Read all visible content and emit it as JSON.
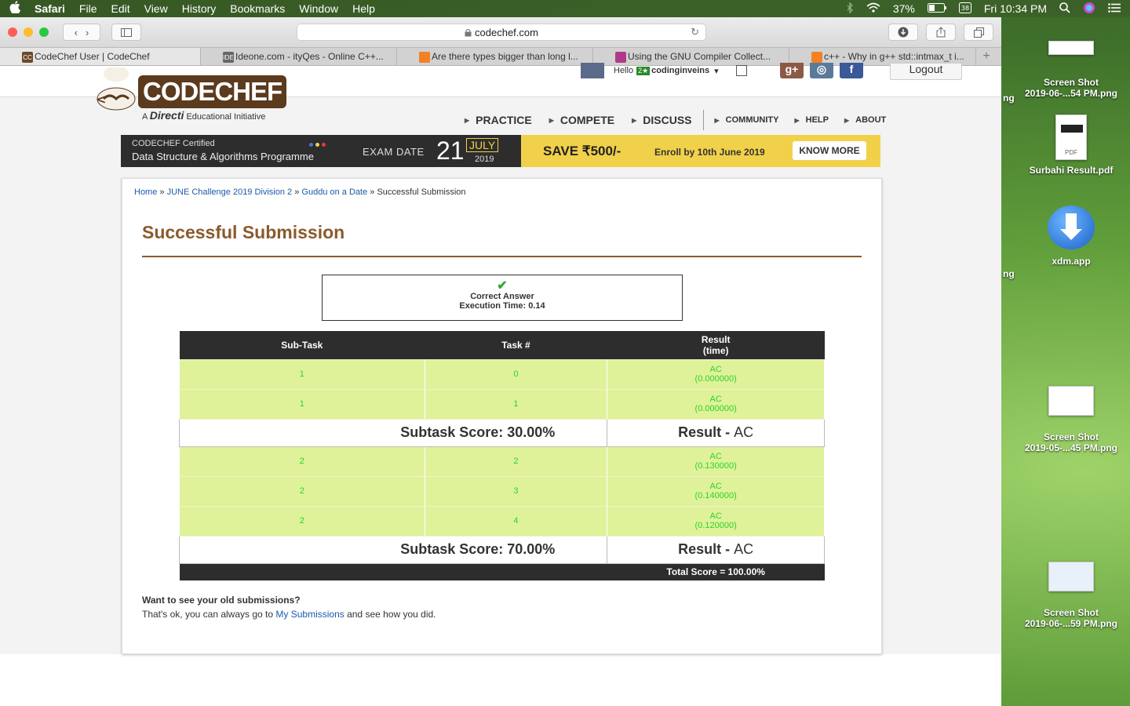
{
  "menubar": {
    "app": "Safari",
    "items": [
      "File",
      "Edit",
      "View",
      "History",
      "Bookmarks",
      "Window",
      "Help"
    ],
    "battery": "37%",
    "clock": "Fri 10:34 PM"
  },
  "browser": {
    "url": "codechef.com",
    "tabs": [
      {
        "title": "CodeChef User | CodeChef",
        "favicon": "CC"
      },
      {
        "title": "Ideone.com - ityQes - Online C++...",
        "favicon": "IDE"
      },
      {
        "title": "Are there types bigger than long l...",
        "favicon": ""
      },
      {
        "title": "Using the GNU Compiler Collect...",
        "favicon": ""
      },
      {
        "title": "c++ - Why in g++ std::intmax_t i...",
        "favicon": ""
      }
    ],
    "new_tab": "+"
  },
  "header": {
    "logo_text": "CODECHEF",
    "logo_sub_prefix": "A",
    "logo_sub_brand": "Directi",
    "logo_sub_suffix": "Educational Initiative",
    "hello": "Hello",
    "username": "codinginveins",
    "logout": "Logout",
    "nav": [
      "PRACTICE",
      "COMPETE",
      "DISCUSS"
    ],
    "nav_small": [
      "COMMUNITY",
      "HELP",
      "ABOUT"
    ]
  },
  "banner": {
    "certified": "CODECHEF Certified",
    "programme": "Data Structure & Algorithms Programme",
    "exam_label": "EXAM DATE",
    "day": "21",
    "month": "JULY",
    "year": "2019",
    "save": "SAVE ₹500/-",
    "enroll": "Enroll by 10th June 2019",
    "cta": "KNOW MORE"
  },
  "breadcrumb": {
    "home": "Home",
    "contest": "JUNE Challenge 2019 Division 2",
    "problem": "Guddu on a Date",
    "current": "Successful Submission",
    "sep": " » "
  },
  "page": {
    "title": "Successful Submission",
    "verdict": "Correct Answer",
    "exec_time": "Execution Time: 0.14"
  },
  "table": {
    "headers": [
      "Sub-Task",
      "Task #",
      "Result",
      "(time)"
    ],
    "groups": [
      {
        "rows": [
          {
            "subtask": "1",
            "task": "0",
            "result": "AC",
            "time": "(0.000000)"
          },
          {
            "subtask": "1",
            "task": "1",
            "result": "AC",
            "time": "(0.000000)"
          }
        ],
        "score": "Subtask Score: 30.00%",
        "result_label": "Result - ",
        "result_value": "AC"
      },
      {
        "rows": [
          {
            "subtask": "2",
            "task": "2",
            "result": "AC",
            "time": "(0.130000)"
          },
          {
            "subtask": "2",
            "task": "3",
            "result": "AC",
            "time": "(0.140000)"
          },
          {
            "subtask": "2",
            "task": "4",
            "result": "AC",
            "time": "(0.120000)"
          }
        ],
        "score": "Subtask Score: 70.00%",
        "result_label": "Result - ",
        "result_value": "AC"
      }
    ],
    "total": "Total Score = 100.00%"
  },
  "footer": {
    "question": "Want to see your old submissions?",
    "answer_prefix": "That's ok, you can always go to ",
    "link": "My Submissions",
    "answer_suffix": " and see how you did."
  },
  "desktop": {
    "icons": [
      {
        "line1": "Screen Shot",
        "line2": "2019-06-...54 PM.png"
      },
      {
        "line1": "Surbahi Result.pdf",
        "line2": ""
      },
      {
        "line1": "xdm.app",
        "line2": ""
      },
      {
        "line1": "Screen Shot",
        "line2": "2019-05-...45 PM.png"
      },
      {
        "line1": "Screen Shot",
        "line2": "2019-06-...59 PM.png"
      }
    ],
    "pdf_badge": "PDF",
    "fragments": [
      "ng",
      "ng"
    ]
  },
  "colors": {
    "brand_brown": "#8b5a2b",
    "ac_green_bg": "#dff29a",
    "ac_text": "#2ad42a",
    "link_blue": "#1a5ba8",
    "header_dark": "#2d2d2d"
  }
}
